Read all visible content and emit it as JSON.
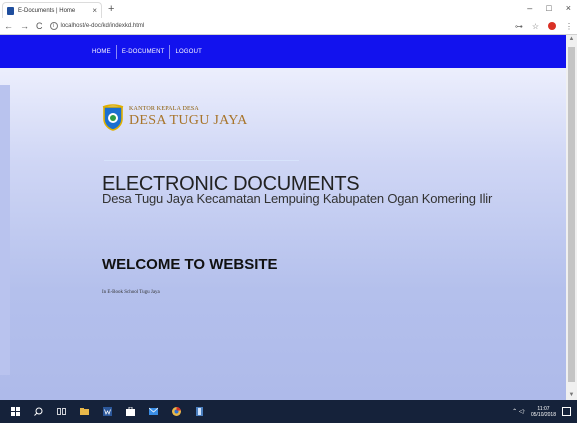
{
  "browser": {
    "tab_title": "E-Documents | Home",
    "tab_close": "×",
    "new_tab": "+",
    "url": "localhost/e-doc/kd/indexkd.html",
    "back": "←",
    "forward": "→",
    "reload": "C",
    "info": "i",
    "minimize": "–",
    "maximize": "□",
    "close": "×",
    "key_icon": "⊶",
    "star_icon": "☆",
    "menu_icon": "⋮"
  },
  "nav": {
    "items": [
      "HOME",
      "E-DOCUMENT",
      "LOGOUT"
    ]
  },
  "logo": {
    "small": "KANTOR KEPALA DESA",
    "big": "DESA TUGU JAYA"
  },
  "header": {
    "title": "ELECTRONIC DOCUMENTS",
    "subtitle": "Desa Tugu Jaya Kecamatan Lempuing Kabupaten Ogan Komering Ilir"
  },
  "welcome": {
    "title": "WELCOME TO WEBSITE",
    "subtitle": "In E-Book School Tugu Jaya"
  },
  "scrollbar": {
    "up": "▲",
    "down": "▼"
  },
  "taskbar": {
    "time": "11:07",
    "date": "05/10/2018",
    "tray_icons": "⌃ ◁ᐧ"
  },
  "colors": {
    "navbar": "#1212ee",
    "taskbar": "#15223a",
    "logo_gold": "#a8742a"
  }
}
